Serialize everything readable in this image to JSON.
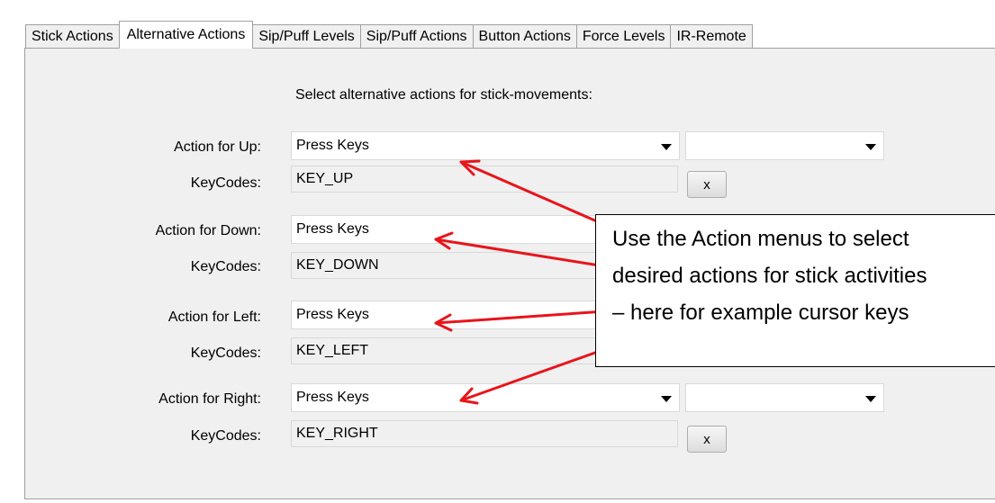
{
  "tabs": [
    {
      "label": "Stick Actions",
      "active": false
    },
    {
      "label": "Alternative Actions",
      "active": true
    },
    {
      "label": "Sip/Puff Levels",
      "active": false
    },
    {
      "label": "Sip/Puff Actions",
      "active": false
    },
    {
      "label": "Button Actions",
      "active": false
    },
    {
      "label": "Force Levels",
      "active": false
    },
    {
      "label": "IR-Remote",
      "active": false
    }
  ],
  "instruction": "Select alternative actions for stick-movements:",
  "rows": [
    {
      "action_label": "Action for Up:",
      "action_value": "Press Keys",
      "keycodes_label": "KeyCodes:",
      "keycodes_value": "KEY_UP",
      "clear_label": "x"
    },
    {
      "action_label": "Action for Down:",
      "action_value": "Press Keys",
      "keycodes_label": "KeyCodes:",
      "keycodes_value": "KEY_DOWN"
    },
    {
      "action_label": "Action for Left:",
      "action_value": "Press Keys",
      "keycodes_label": "KeyCodes:",
      "keycodes_value": "KEY_LEFT"
    },
    {
      "action_label": "Action for Right:",
      "action_value": "Press Keys",
      "keycodes_label": "KeyCodes:",
      "keycodes_value": "KEY_RIGHT",
      "clear_label": "x"
    }
  ],
  "callout": {
    "lines": [
      "Use the Action menus to select",
      "desired actions for stick activities",
      "– here for example cursor keys"
    ],
    "arrow_color": "#e8141b"
  }
}
